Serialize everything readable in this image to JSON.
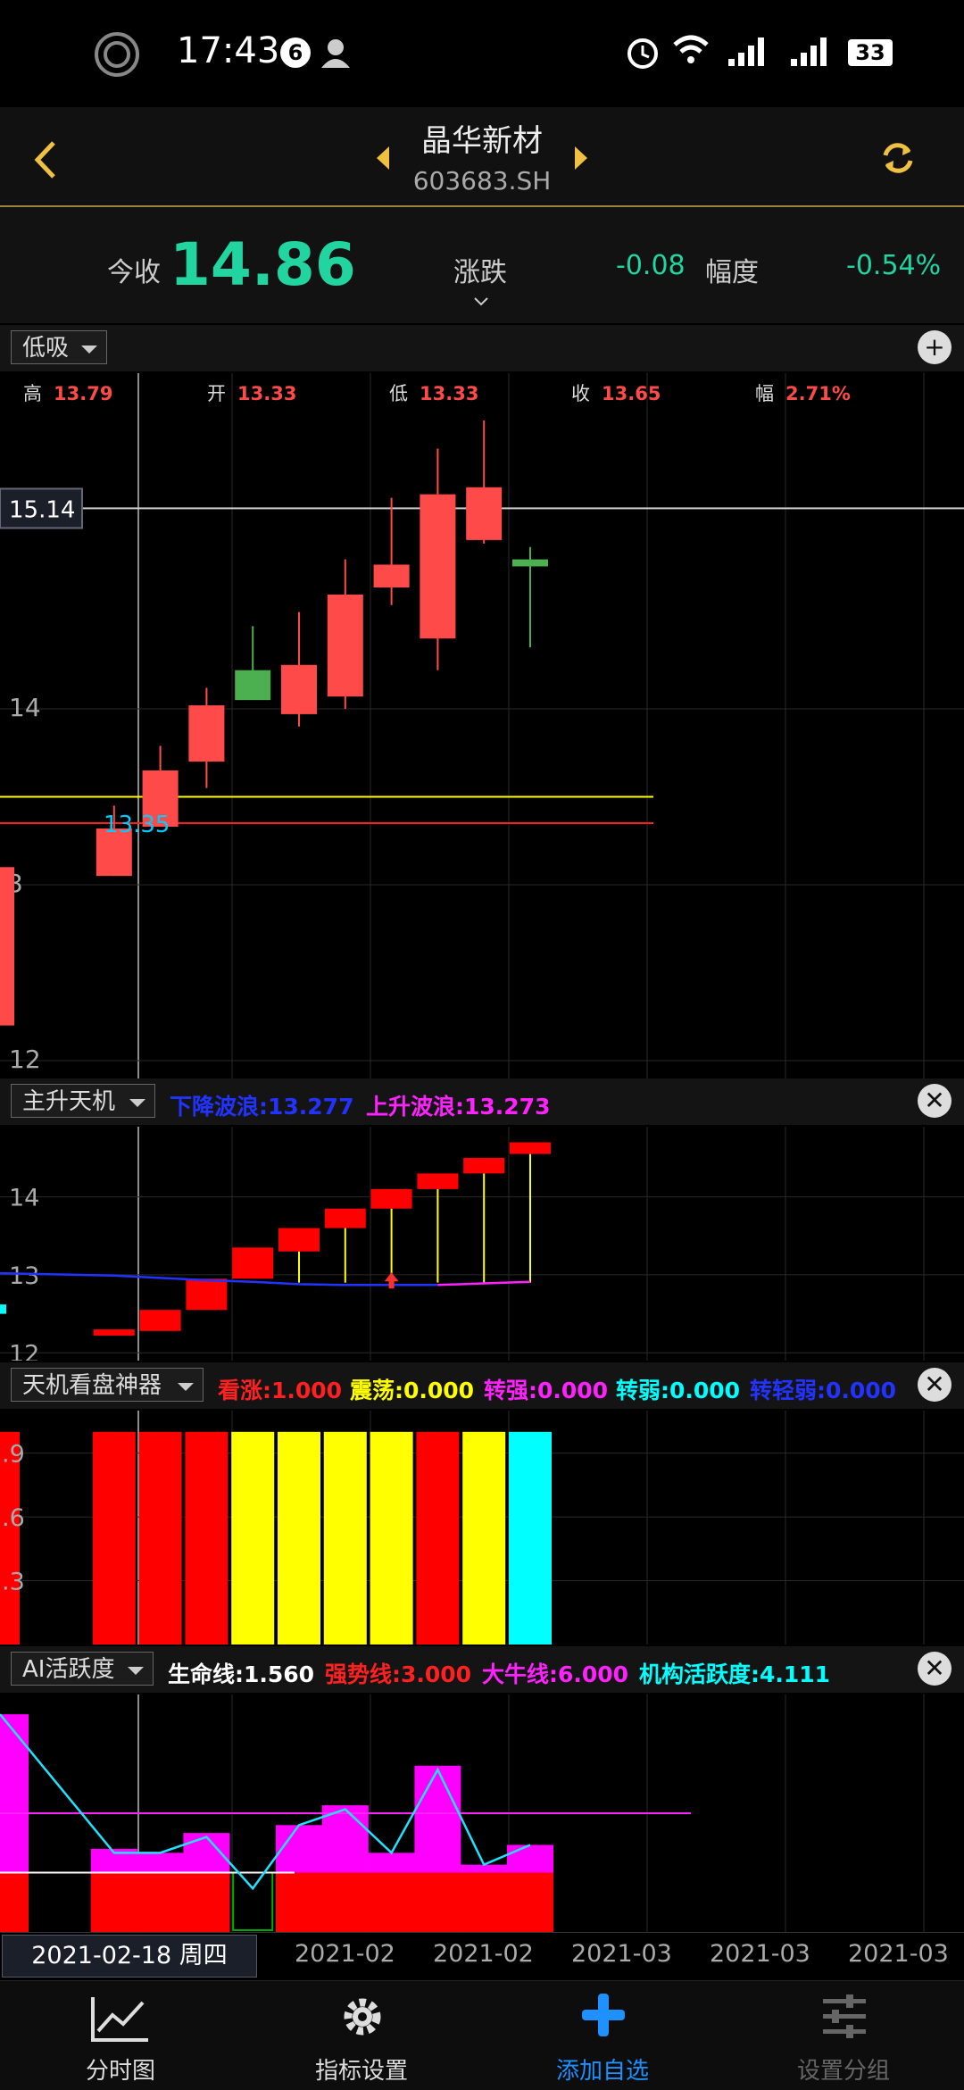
{
  "status": {
    "time": "17:43",
    "notif_count": "6",
    "battery": "33"
  },
  "header": {
    "stock_name": "晶华新材",
    "stock_code": "603683.SH"
  },
  "quote": {
    "close_label": "今收",
    "close_value": "14.86",
    "change_label": "涨跌",
    "change_value": "-0.08",
    "pct_label": "幅度",
    "pct_value": "-0.54%"
  },
  "main_panel": {
    "selector": "低吸",
    "ohlc": [
      {
        "label": "高",
        "value": "13.79"
      },
      {
        "label": "开",
        "value": "13.33"
      },
      {
        "label": "低",
        "value": "13.33"
      },
      {
        "label": "收",
        "value": "13.65"
      },
      {
        "label": "幅",
        "value": "2.71%"
      }
    ],
    "price_tag": "15.14",
    "cursor_value": "13.35",
    "y_ticks": [
      "14",
      "13",
      "12"
    ]
  },
  "panel2": {
    "selector": "主升天机",
    "indicators": [
      {
        "label": "下降波浪:13.277",
        "color": "#2233ff"
      },
      {
        "label": "上升波浪:13.273",
        "color": "#ff22ff"
      }
    ],
    "y_ticks": [
      "14",
      "13",
      "12"
    ]
  },
  "panel3": {
    "selector": "天机看盘神器",
    "indicators": [
      {
        "label": "看涨:1.000",
        "color": "#ff2020"
      },
      {
        "label": "震荡:0.000",
        "color": "#ffff00"
      },
      {
        "label": "转强:0.000",
        "color": "#ff22ff"
      },
      {
        "label": "转弱:0.000",
        "color": "#00ffff"
      },
      {
        "label": "转轻弱:0.000",
        "color": "#2233ff"
      }
    ],
    "y_ticks": [
      ".9",
      ".6",
      ".3"
    ]
  },
  "panel4": {
    "selector": "AI活跃度",
    "indicators": [
      {
        "label": "生命线:1.560",
        "color": "#ffffff"
      },
      {
        "label": "强势线:3.000",
        "color": "#ff2020"
      },
      {
        "label": "大牛线:6.000",
        "color": "#ff22ff"
      },
      {
        "label": "机构活跃度:4.111",
        "color": "#00ffff"
      }
    ]
  },
  "date_axis": {
    "cursor_date": "2021-02-18 周四",
    "labels": [
      "2021-02",
      "2021-02",
      "2021-03",
      "2021-03",
      "2021-03"
    ]
  },
  "nav": [
    {
      "label": "分时图",
      "icon": "line-chart-icon"
    },
    {
      "label": "指标设置",
      "icon": "gear-icon"
    },
    {
      "label": "添加自选",
      "icon": "plus-icon"
    },
    {
      "label": "设置分组",
      "icon": "sliders-icon"
    }
  ],
  "colors": {
    "up": "#ff4a4a",
    "down": "#4caf50",
    "accent": "#f0c040",
    "quote_green": "#22d4a0",
    "nav_active": "#1e90ff"
  },
  "chart_data": [
    {
      "type": "candlestick",
      "title": "",
      "ylim": [
        12,
        15.14
      ],
      "candles": [
        {
          "o": 12.2,
          "h": 13.1,
          "l": 12.1,
          "c": 13.1
        },
        {
          "o": 13.05,
          "h": 13.45,
          "l": 13.05,
          "c": 13.32
        },
        {
          "o": 13.33,
          "h": 13.79,
          "l": 13.33,
          "c": 13.65
        },
        {
          "o": 13.7,
          "h": 14.12,
          "l": 13.55,
          "c": 14.02
        },
        {
          "o": 14.22,
          "h": 14.47,
          "l": 14.1,
          "c": 14.05
        },
        {
          "o": 13.97,
          "h": 14.55,
          "l": 13.9,
          "c": 14.25
        },
        {
          "o": 14.07,
          "h": 14.85,
          "l": 14.0,
          "c": 14.65
        },
        {
          "o": 14.69,
          "h": 15.2,
          "l": 14.59,
          "c": 14.82
        },
        {
          "o": 14.4,
          "h": 15.48,
          "l": 14.22,
          "c": 15.22
        },
        {
          "o": 14.96,
          "h": 15.64,
          "l": 14.94,
          "c": 15.26
        },
        {
          "o": 14.85,
          "h": 14.92,
          "l": 14.35,
          "c": 14.81
        }
      ],
      "hlines": [
        {
          "value": 13.5,
          "color": "#ffff00"
        },
        {
          "value": 13.35,
          "color": "#ff2020"
        },
        {
          "value": 15.14,
          "color": "#cccccc"
        }
      ]
    },
    {
      "type": "bar",
      "title": "主升天机",
      "boxes": [
        {
          "top": 12.62,
          "bot": 12.5,
          "color": "#00ffff"
        },
        {
          "top": 12.3,
          "bot": 12.22,
          "color": "#ff0000"
        },
        {
          "top": 12.55,
          "bot": 12.28,
          "color": "#ff0000"
        },
        {
          "top": 12.95,
          "bot": 12.55,
          "color": "#ff0000"
        },
        {
          "top": 13.35,
          "bot": 12.95,
          "color": "#ff0000"
        },
        {
          "top": 13.6,
          "bot": 13.3,
          "color": "#ff0000"
        },
        {
          "top": 13.85,
          "bot": 13.6,
          "color": "#ff0000"
        },
        {
          "top": 14.1,
          "bot": 13.85,
          "color": "#ff0000"
        },
        {
          "top": 14.3,
          "bot": 14.1,
          "color": "#ff0000"
        },
        {
          "top": 14.5,
          "bot": 14.3,
          "color": "#ff0000"
        },
        {
          "top": 14.7,
          "bot": 14.55,
          "color": "#ff0000"
        }
      ],
      "down_wave": [
        13.02,
        12.99,
        12.96,
        12.93,
        12.91,
        12.88,
        12.87,
        12.87,
        12.87
      ],
      "up_wave": [
        12.87,
        12.89,
        12.91
      ],
      "ylim": [
        11.9,
        14.9
      ]
    },
    {
      "type": "bar",
      "title": "天机看盘神器",
      "values": [
        1,
        1,
        1,
        1,
        1,
        1,
        1,
        1,
        1,
        1,
        1
      ],
      "colors": [
        "#ff0000",
        "#ff0000",
        "#ff0000",
        "#ff0000",
        "#ffff00",
        "#ffff00",
        "#ffff00",
        "#ffff00",
        "#ff0000",
        "#ffff00",
        "#00ffff"
      ],
      "ylim": [
        0,
        1.1
      ]
    },
    {
      "type": "bar",
      "title": "AI活跃度",
      "red": [
        1.5,
        1.5,
        1.5,
        1.5,
        1.5,
        1.5,
        1.5,
        1.5,
        1.5,
        1.5,
        1.5
      ],
      "magenta": [
        5.5,
        2.1,
        2.0,
        2.5,
        0,
        2.7,
        3.2,
        2.0,
        4.2,
        1.7,
        2.2
      ],
      "line": [
        5.5,
        2.0,
        2.0,
        2.4,
        1.1,
        2.7,
        3.1,
        2.0,
        4.1,
        1.7,
        2.2
      ],
      "hlines": [
        {
          "value": 3.0,
          "color": "#ff22ff"
        },
        {
          "value": 1.5,
          "color": "#ffffff"
        }
      ],
      "ylim": [
        0,
        6
      ]
    }
  ]
}
